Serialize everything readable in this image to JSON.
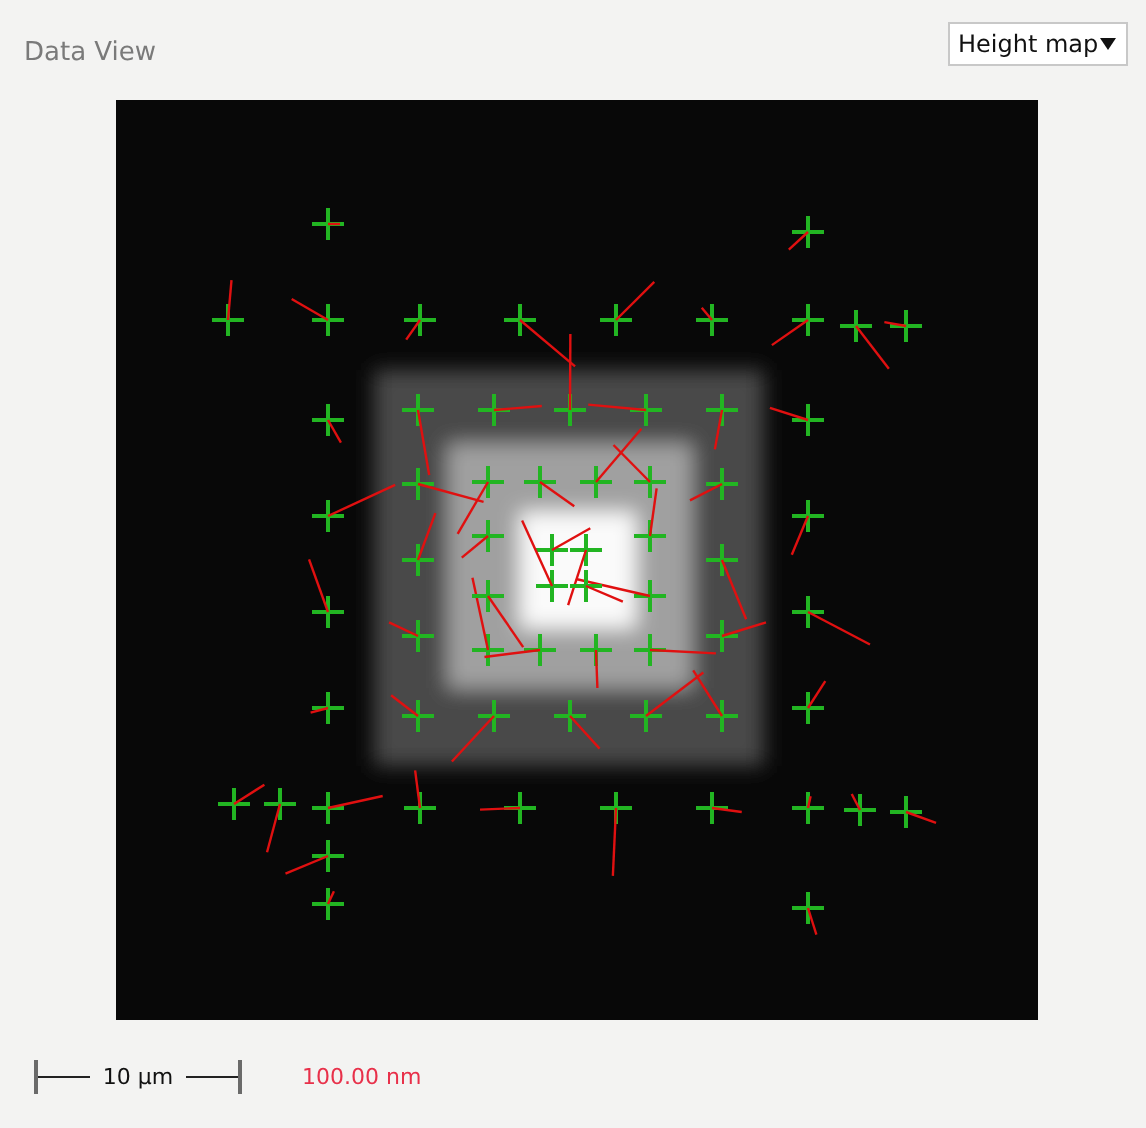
{
  "title": "Data View",
  "view_select": {
    "value": "Height map"
  },
  "scale_bar": {
    "label": "10 µm"
  },
  "height_range": "100.00 nm"
}
